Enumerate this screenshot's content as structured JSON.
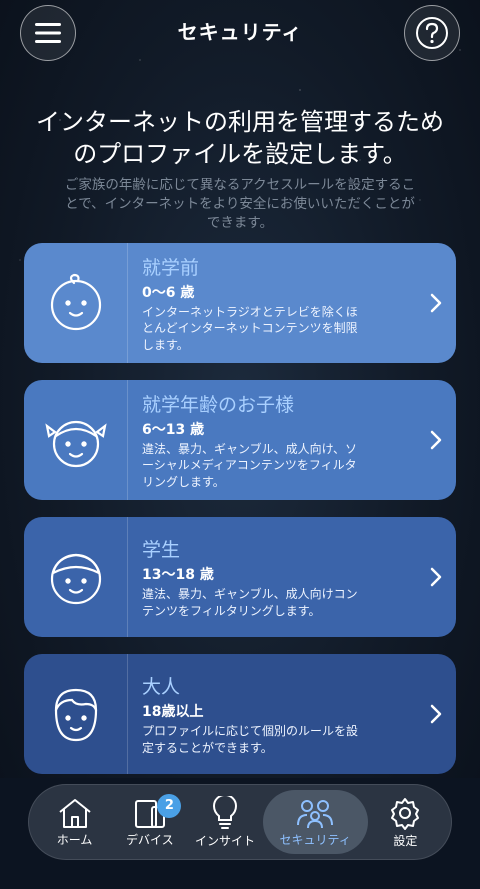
{
  "header": {
    "title": "セキュリティ",
    "menu_icon": "hamburger-menu-icon",
    "help_icon": "question-circle-icon"
  },
  "intro": {
    "headline_line1": "インターネットの利用を管理するため",
    "headline_line2": "のプロファイルを設定します。",
    "sub_line1": "ご家族の年齢に応じて異なるアクセスルールを設定するこ",
    "sub_line2": "とで、インターネットをより安全にお使いいただくことが",
    "sub_line3": "できます。"
  },
  "profiles": [
    {
      "title": "就学前",
      "age": "0〜6 歳",
      "desc_line1": "インターネットラジオとテレビを除くほ",
      "desc_line2": "とんどインターネットコンテンツを制限",
      "desc_line3": "します。",
      "icon": "baby-face-icon"
    },
    {
      "title": "就学年齢のお子様",
      "age": "6〜13 歳",
      "desc_line1": "違法、暴力、ギャンブル、成人向け、ソ",
      "desc_line2": "ーシャルメディアコンテンツをフィルタ",
      "desc_line3": "リングします。",
      "icon": "girl-face-icon"
    },
    {
      "title": "学生",
      "age": "13〜18 歳",
      "desc_line1": "違法、暴力、ギャンブル、成人向けコン",
      "desc_line2": "テンツをフィルタリングします。",
      "desc_line3": "",
      "icon": "teen-face-icon"
    },
    {
      "title": "大人",
      "age": "18歳以上",
      "desc_line1": "プロファイルに応じて個別のルールを設",
      "desc_line2": "定することができます。",
      "desc_line3": "",
      "icon": "adult-face-icon"
    }
  ],
  "tabbar": {
    "tabs": [
      {
        "label": "ホーム",
        "icon": "home-icon"
      },
      {
        "label": "デバイス",
        "icon": "devices-icon",
        "badge": "2"
      },
      {
        "label": "インサイト",
        "icon": "lightbulb-icon"
      },
      {
        "label": "セキュリティ",
        "icon": "family-icon",
        "active": true
      },
      {
        "label": "設定",
        "icon": "gear-icon"
      }
    ]
  },
  "colors": {
    "card1": "#5a89cd",
    "card2": "#4a79c0",
    "card3": "#3b64aa",
    "card4": "#2e4f8e",
    "accent_title": "#a9d0ff",
    "tab_active_label": "#8ec0ff",
    "badge": "#4aa0e6"
  }
}
